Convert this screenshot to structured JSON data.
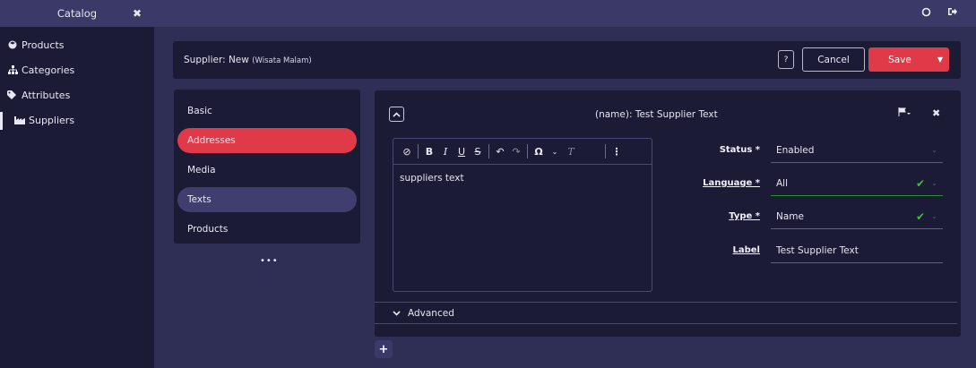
{
  "sidebar": {
    "title": "Catalog",
    "close": "✖",
    "items": [
      {
        "label": "Products",
        "icon": "cube-icon"
      },
      {
        "label": "Categories",
        "icon": "sitemap-icon"
      },
      {
        "label": "Attributes",
        "icon": "tag-icon"
      },
      {
        "label": "Suppliers",
        "icon": "factory-icon"
      }
    ]
  },
  "topbar": {
    "icons": [
      "settings-icon",
      "logout-icon"
    ]
  },
  "header": {
    "title": "Supplier: New",
    "subtitle": "(Wisata Malam)",
    "help_label": "?",
    "cancel_label": "Cancel",
    "save_label": "Save"
  },
  "tabs": [
    {
      "label": "Basic"
    },
    {
      "label": "Addresses"
    },
    {
      "label": "Media"
    },
    {
      "label": "Texts"
    },
    {
      "label": "Products"
    }
  ],
  "more_label": "•••",
  "panel": {
    "title": "(name): Test Supplier Text",
    "editor_text": "suppliers text",
    "form": {
      "status_label": "Status *",
      "status_value": "Enabled",
      "language_label": "Language *",
      "language_value": "All",
      "type_label": "Type *",
      "type_value": "Name",
      "label_label": "Label",
      "label_value": "Test Supplier Text"
    },
    "advanced_label": "Advanced"
  },
  "add_label": "+",
  "colors": {
    "accent": "#e03a48",
    "sidebar_bg": "#1c1b35",
    "page_bg": "#2f2e55",
    "success": "#3fbf3f"
  }
}
